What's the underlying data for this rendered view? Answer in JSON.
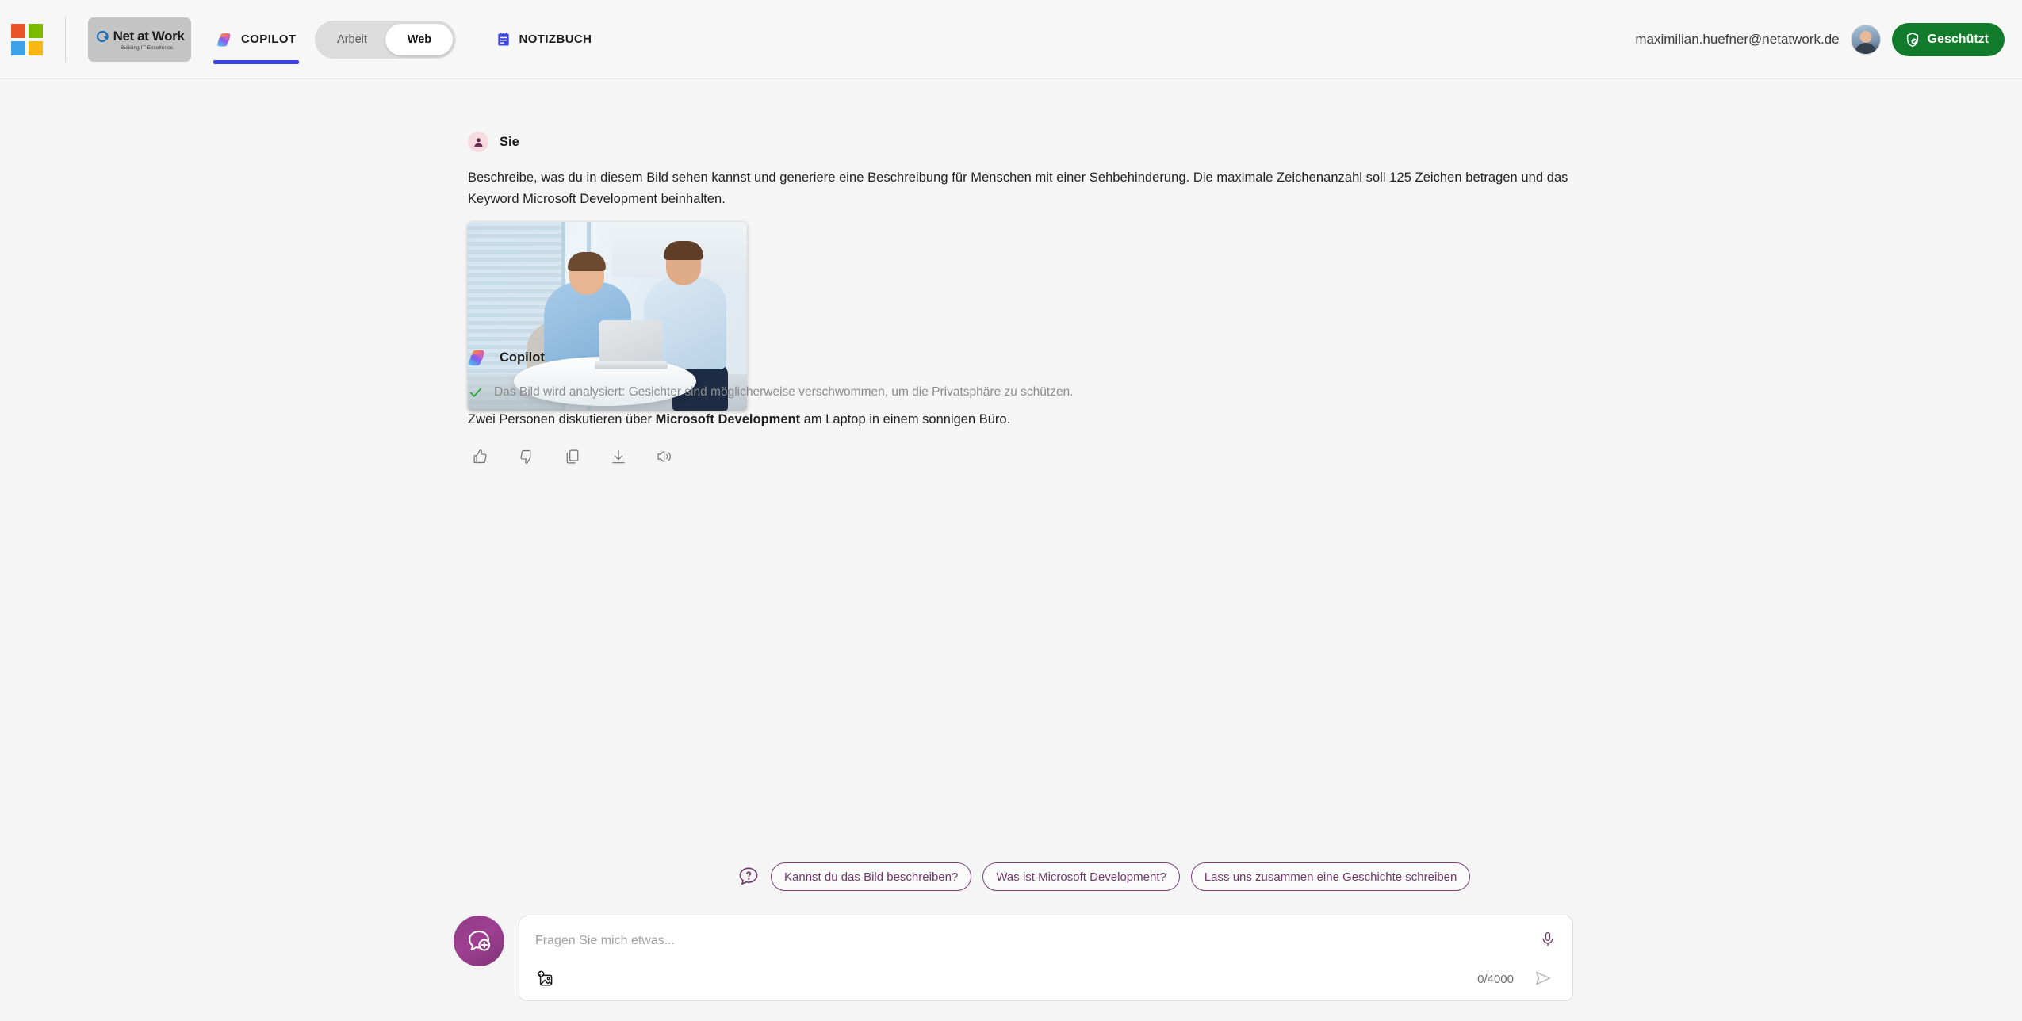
{
  "header": {
    "ms_logo_colors": [
      "#e8532a",
      "#7cba00",
      "#3da2e8",
      "#f9b713"
    ],
    "brand": {
      "name": "Net at Work",
      "tagline": "Building IT-Excellence.",
      "icon": "net-at-work-logo-icon"
    },
    "tabs": [
      {
        "id": "copilot",
        "label": "COPILOT",
        "icon": "copilot-icon",
        "active": true
      },
      {
        "id": "notizbuch",
        "label": "NOTIZBUCH",
        "icon": "notebook-icon",
        "active": false
      }
    ],
    "mode_toggle": {
      "options": [
        "Arbeit",
        "Web"
      ],
      "selected": "Web"
    },
    "user_email": "maximilian.huefner@netatwork.de",
    "avatar_icon": "user-avatar",
    "protected_badge": {
      "label": "Geschützt",
      "icon": "shield-check-icon",
      "color": "#127a2b"
    }
  },
  "conversation": {
    "user_message": {
      "author": "Sie",
      "avatar_icon": "person-icon",
      "text": "Beschreibe, was du in diesem Bild sehen kannst und generiere eine Beschreibung für Menschen mit einer Sehbehinderung. Die maximale Zeichenanzahl soll 125 Zeichen betragen und das Keyword Microsoft Development beinhalten.",
      "attachment": {
        "name": "attached-photo",
        "alt": "Zwei Männer in hellblauen Hemden blicken lächelnd auf einen Laptop an einem runden Tisch in einem hellen Büro"
      }
    },
    "assistant_message": {
      "author": "Copilot",
      "avatar_icon": "copilot-icon",
      "analysis_note": "Das Bild wird analysiert: Gesichter sind möglicherweise verschwommen, um die Privatsphäre zu schützen.",
      "analysis_icon": "check-icon",
      "analysis_icon_color": "#2eaa3c",
      "answer_prefix": "Zwei Personen diskutieren über ",
      "answer_bold": "Microsoft Development",
      "answer_suffix": " am Laptop in einem sonnigen Büro.",
      "actions": [
        {
          "id": "like",
          "icon": "thumbs-up-icon"
        },
        {
          "id": "dislike",
          "icon": "thumbs-down-icon"
        },
        {
          "id": "copy",
          "icon": "copy-icon"
        },
        {
          "id": "download",
          "icon": "download-icon"
        },
        {
          "id": "read-aloud",
          "icon": "speaker-icon"
        }
      ]
    }
  },
  "suggestions": {
    "icon": "question-bubble-icon",
    "accent": "#70386b",
    "chips": [
      "Kannst du das Bild beschreiben?",
      "Was ist Microsoft Development?",
      "Lass uns zusammen eine Geschichte schreiben"
    ]
  },
  "composer": {
    "new_chat_icon": "new-chat-bubble-icon",
    "placeholder": "Fragen Sie mich etwas...",
    "value": "",
    "mic_icon": "microphone-icon",
    "attach_icon": "add-image-icon",
    "char_count": "0/4000",
    "send_icon": "send-icon"
  }
}
